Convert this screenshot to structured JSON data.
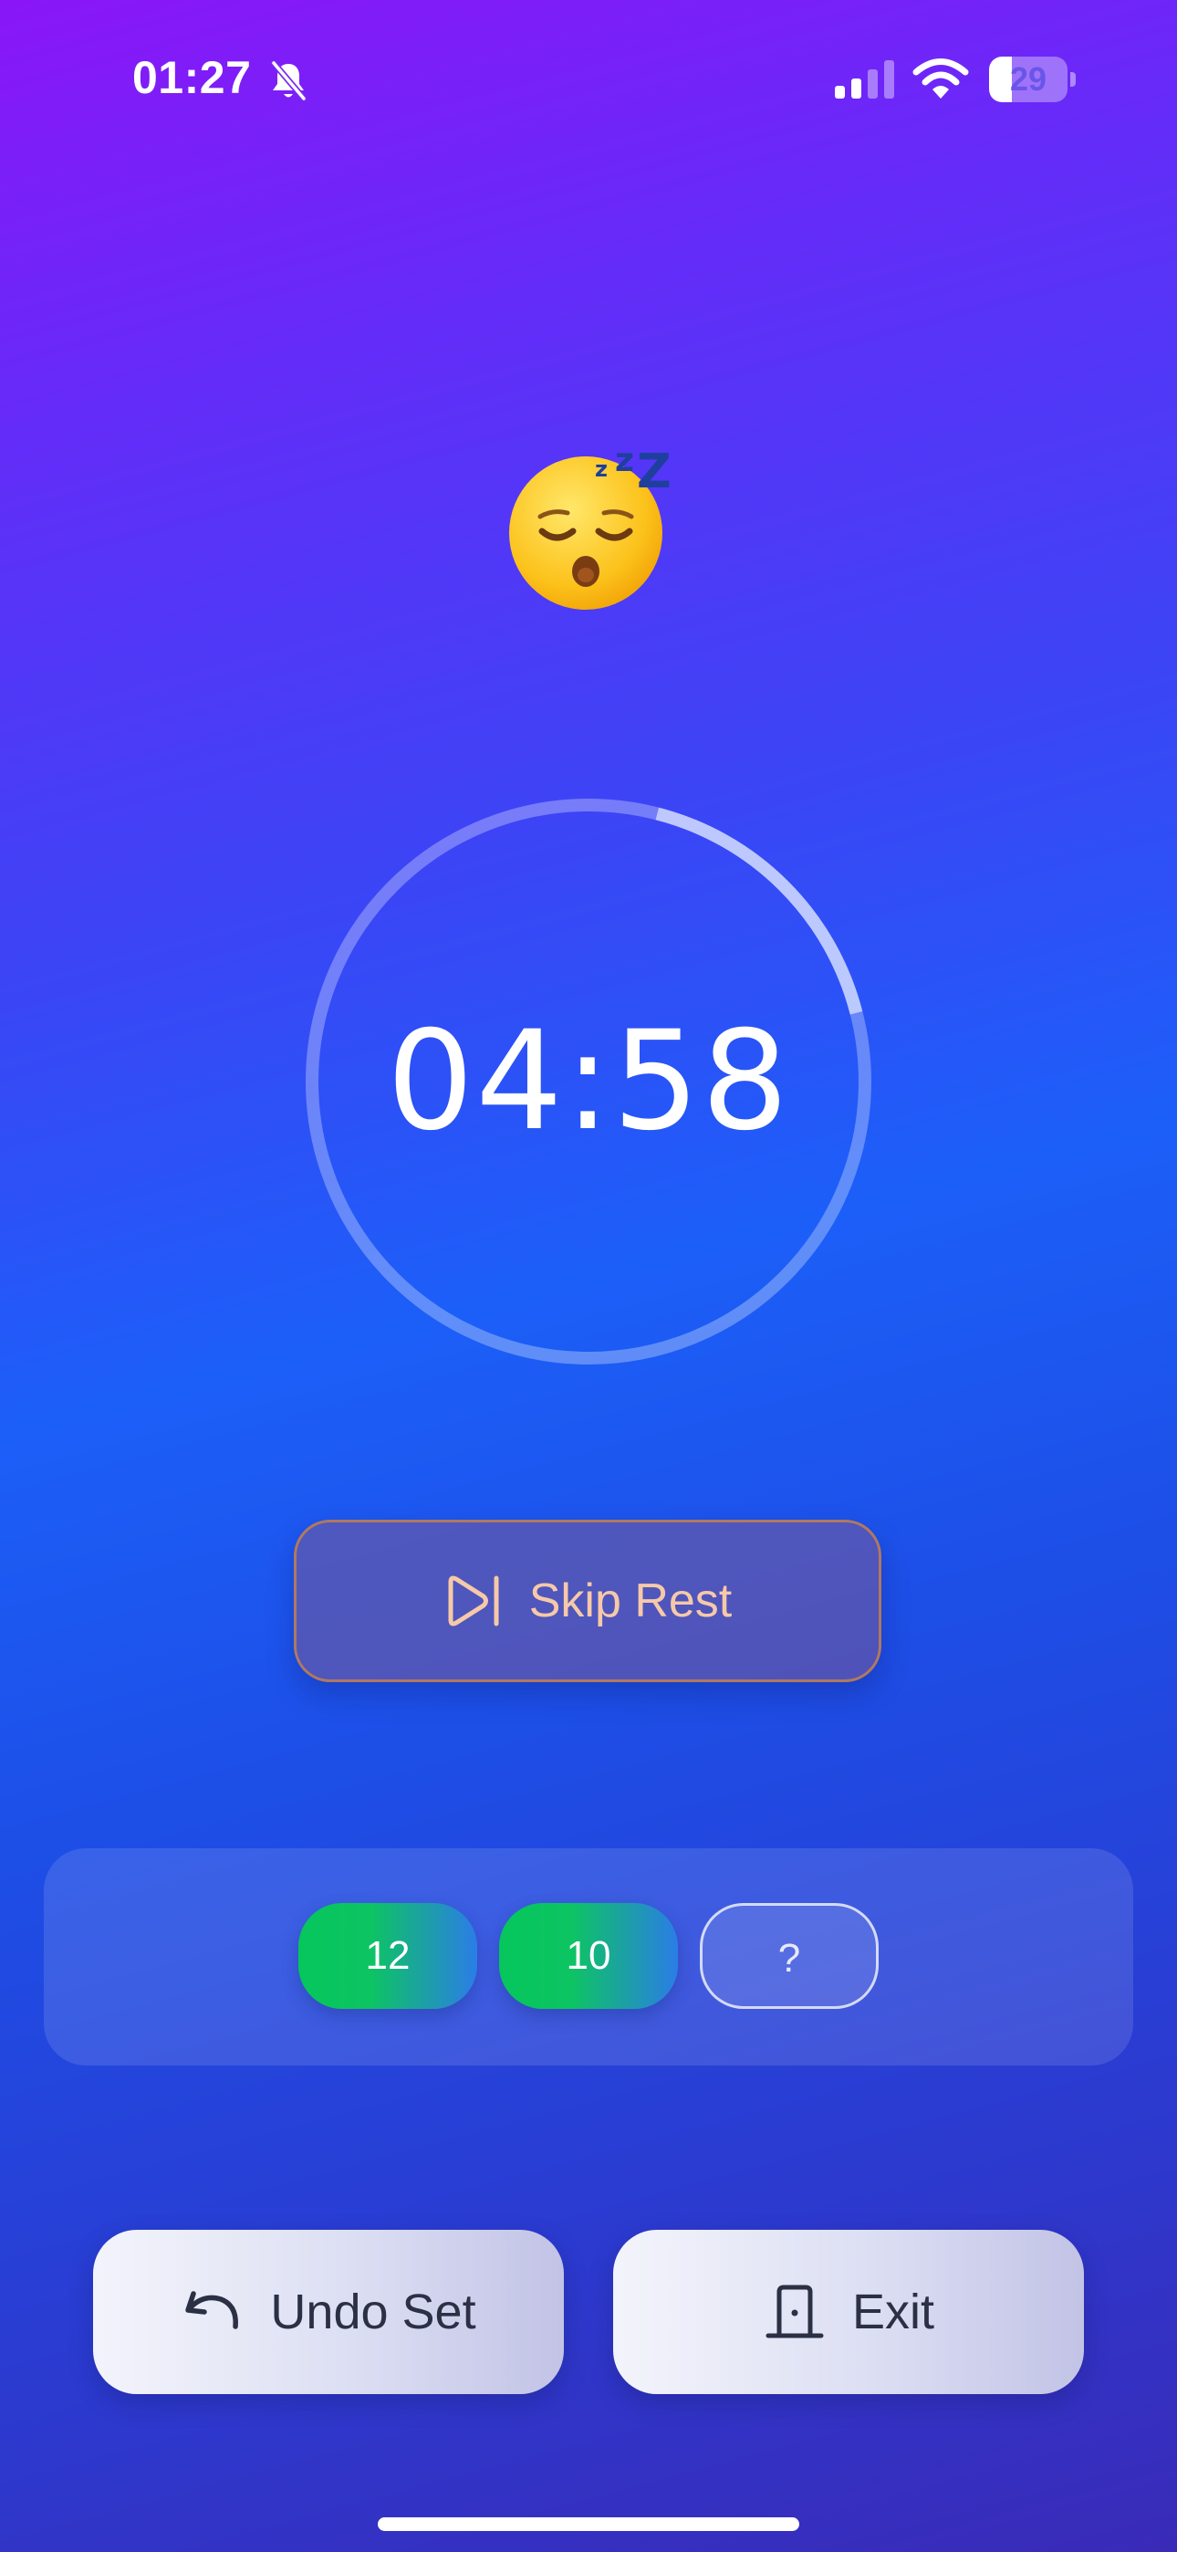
{
  "status_bar": {
    "time": "01:27",
    "silent_icon": "bell-slash-icon",
    "signal_icon": "cellular-signal-icon",
    "signal_bars_active": 2,
    "signal_bars_total": 4,
    "wifi_icon": "wifi-icon",
    "battery_percent": "29",
    "battery_level": 0.29
  },
  "rest": {
    "emoji": "sleeping-face-emoji",
    "timer": "04:58",
    "progress_remaining": 0.83,
    "skip_label": "Skip Rest",
    "skip_icon": "skip-forward-icon"
  },
  "sets": [
    {
      "reps": "12",
      "state": "done"
    },
    {
      "reps": "10",
      "state": "done"
    },
    {
      "reps": "?",
      "state": "pending"
    }
  ],
  "actions": {
    "undo_label": "Undo Set",
    "undo_icon": "undo-arrow-icon",
    "exit_label": "Exit",
    "exit_icon": "door-icon"
  },
  "colors": {
    "background_top": "#8a16f7",
    "background_mid": "#1c5ff8",
    "background_bottom": "#3a2ab8",
    "skip_text": "#f6c9a8",
    "skip_border": "#b0795f",
    "set_done_start": "#05c65c",
    "set_done_end": "#2b7de6"
  }
}
